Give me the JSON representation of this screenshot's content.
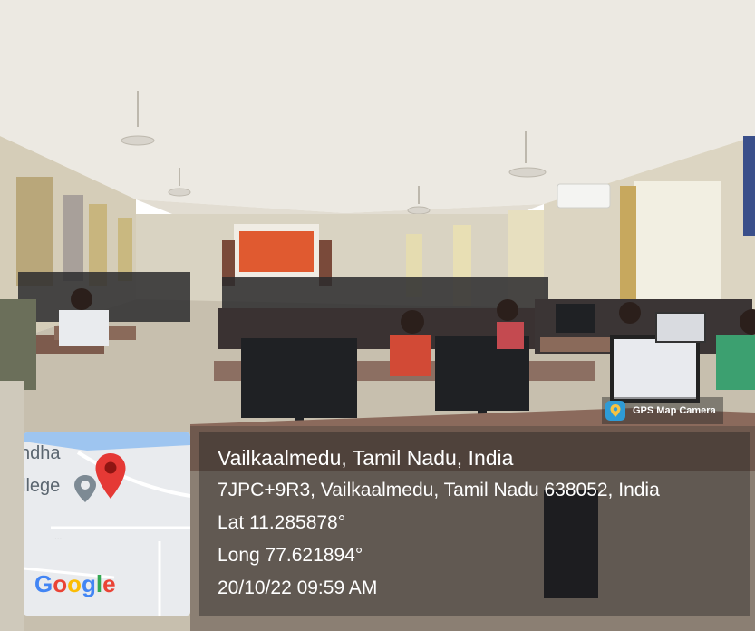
{
  "photo": {
    "subject": "computer-lab-classroom",
    "colors": {
      "wall": "#d9d3c2",
      "ceiling": "#ece9e2",
      "floor": "#c7bfae",
      "projector_screen": "#e05a30",
      "monitor": "#1f2124"
    }
  },
  "badge": {
    "label": "GPS Map Camera",
    "icon": "gps-map-camera-icon"
  },
  "map": {
    "label_line1": "ndha",
    "label_line2": "llege",
    "pin_icon": "map-pin-icon",
    "place_icon": "place-marker-icon",
    "logo_text": {
      "g1": "G",
      "g2": "o",
      "g3": "o",
      "g4": "g",
      "g5": "l",
      "g6": "e"
    },
    "logo_colors": [
      "#4285f4",
      "#ea4335",
      "#fbbc05",
      "#4285f4",
      "#34a853",
      "#ea4335"
    ]
  },
  "geotag": {
    "location": "Vailkaalmedu, Tamil Nadu, India",
    "address": "7JPC+9R3, Vailkaalmedu, Tamil Nadu 638052, India",
    "latitude": "Lat 11.285878°",
    "longitude": "Long 77.621894°",
    "datetime": "20/10/22 09:59 AM"
  }
}
